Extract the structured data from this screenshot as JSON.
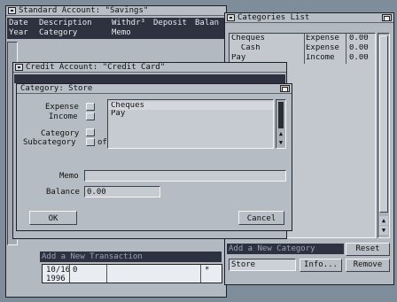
{
  "savings_window": {
    "title": "Standard Account: \"Savings\"",
    "columns": [
      "Date",
      "Description",
      "Withdr³",
      "Deposit",
      "Balan"
    ],
    "subcolumns": [
      "Year",
      "Category",
      "Memo"
    ],
    "new_transaction_label": "Add a New Transaction",
    "entry_date": "10/16",
    "entry_year": "1996",
    "entry_number": "0",
    "entry_marker": "*"
  },
  "credit_window": {
    "title": "Credit Account: \"Credit Card\""
  },
  "categories_window": {
    "title": "Categories List",
    "rows": [
      {
        "name": "Cheques",
        "type": "Expense",
        "amount": "0.00"
      },
      {
        "name": "  Cash",
        "type": "Expense",
        "amount": "0.00"
      },
      {
        "name": "Pay",
        "type": "Income",
        "amount": "0.00"
      }
    ],
    "add_label": "Add a New Category",
    "reset_label": "Reset",
    "new_category_value": "Store",
    "info_label": "Info...",
    "remove_label": "Remove"
  },
  "category_dialog": {
    "title": "Category: Store",
    "expense_label": "Expense",
    "income_label": "Income",
    "category_label": "Category",
    "subcategory_label": "Subcategory",
    "of_label": "of",
    "list_items": [
      "Cheques",
      "Pay"
    ],
    "memo_label": "Memo",
    "memo_value": "",
    "balance_label": "Balance",
    "balance_value": "0.00",
    "ok_label": "OK",
    "cancel_label": "Cancel"
  },
  "colors": {
    "desktop": "#7f8c9a",
    "window": "#b3b9c1",
    "header_dark": "#2d3140"
  }
}
